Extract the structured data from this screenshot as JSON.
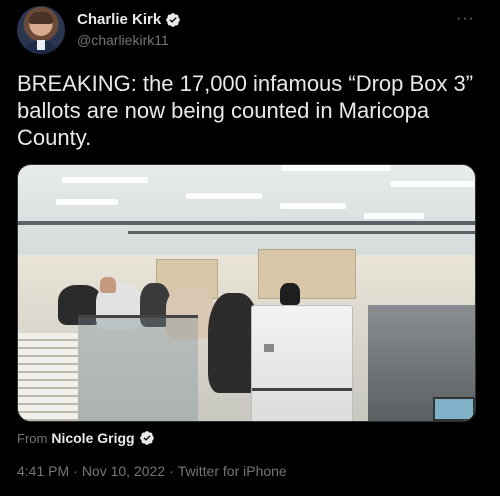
{
  "author": {
    "display_name": "Charlie Kirk",
    "handle": "@charliekirk11",
    "verified": true
  },
  "menu": {
    "more_label": "···"
  },
  "tweet": {
    "text": "BREAKING: the 17,000 infamous “Drop Box 3” ballots are now being counted in Maricopa County."
  },
  "media": {
    "attribution_prefix": "From",
    "attribution_name": "Nicole Grigg",
    "attribution_verified": true
  },
  "meta": {
    "time": "4:41 PM",
    "separator1": "·",
    "date": "Nov 10, 2022",
    "separator2": "·",
    "source": "Twitter for iPhone"
  },
  "colors": {
    "background": "#000000",
    "text_primary": "#e7e9ea",
    "text_secondary": "#71767b",
    "verified_badge": "#e7e9ea"
  }
}
